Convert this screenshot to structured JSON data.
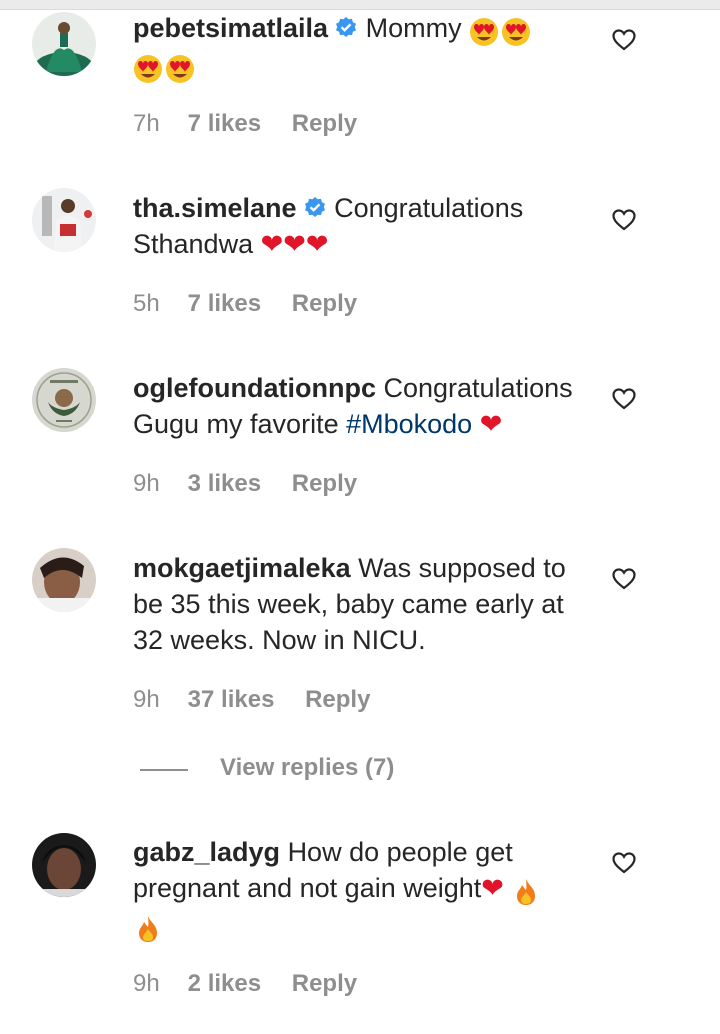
{
  "comments": [
    {
      "username": "pebetsimatlaila",
      "verified": true,
      "text": "Mommy",
      "emojis": [
        "heart-eyes",
        "heart-eyes",
        "heart-eyes",
        "heart-eyes"
      ],
      "time": "7h",
      "likes": "7 likes",
      "reply": "Reply"
    },
    {
      "username": "tha.simelane",
      "verified": true,
      "text": "Congratulations Sthandwa",
      "emojis": [
        "red-heart",
        "red-heart",
        "red-heart"
      ],
      "time": "5h",
      "likes": "7 likes",
      "reply": "Reply"
    },
    {
      "username": "oglefoundationnpc",
      "verified": false,
      "text": "Congratulations Gugu my favorite",
      "hashtag": "#Mbokodo",
      "emojis": [
        "red-heart"
      ],
      "time": "9h",
      "likes": "3 likes",
      "reply": "Reply"
    },
    {
      "username": "mokgaetjimaleka",
      "verified": false,
      "text": "Was supposed to be 35 this week, baby came early at 32 weeks. Now in NICU.",
      "time": "9h",
      "likes": "37 likes",
      "reply": "Reply"
    },
    {
      "username": "gabz_ladyg",
      "verified": false,
      "text": "How do people get pregnant and not gain weight",
      "emojis": [
        "red-heart",
        "fire",
        "fire"
      ],
      "time": "9h",
      "likes": "2 likes",
      "reply": "Reply"
    }
  ],
  "view_replies": "View replies (7)",
  "colors": {
    "text": "#262626",
    "meta": "#8e8e8e",
    "hashtag": "#00376b",
    "verified": "#3897f0",
    "heart": "#e0152a"
  }
}
